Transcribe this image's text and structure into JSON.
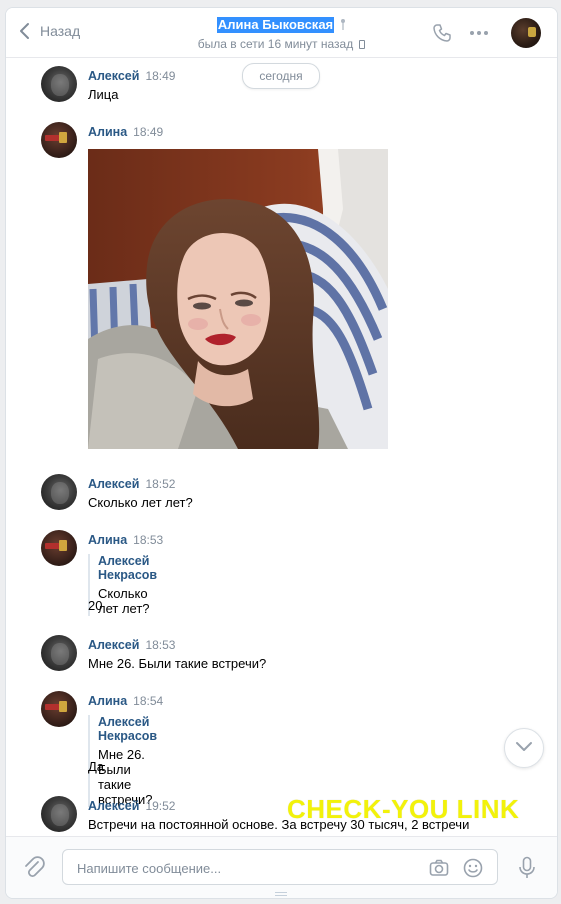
{
  "header": {
    "back_label": "Назад",
    "contact_name": "Алина Быковская",
    "status": "была в сети 16 минут назад"
  },
  "date_separator": "сегодня",
  "messages": [
    {
      "author": "Алексей",
      "time": "18:49",
      "text": "Лица"
    },
    {
      "author": "Алина",
      "time": "18:49",
      "attachment": "photo"
    },
    {
      "author": "Алексей",
      "time": "18:52",
      "text": "Сколько лет лет?"
    },
    {
      "author": "Алина",
      "time": "18:53",
      "quote_author": "Алексей Некрасов",
      "quote_text": "Сколько лет лет?",
      "text": "20"
    },
    {
      "author": "Алексей",
      "time": "18:53",
      "text": "Мне 26. Были такие встречи?"
    },
    {
      "author": "Алина",
      "time": "18:54",
      "quote_author": "Алексей Некрасов",
      "quote_text": "Мне 26. Были такие встречи?",
      "text": "Да"
    },
    {
      "author": "Алексей",
      "time": "19:52",
      "text": "Встречи на постоянной основе. За встречу 30 тысяч, 2 встречи"
    }
  ],
  "watermark": "CHECK-YOU LINK",
  "composer": {
    "placeholder": "Напишите сообщение..."
  },
  "colors": {
    "accent": "#2a5885",
    "selection": "#3390ff",
    "muted": "#818c99",
    "watermark": "#f2f20a"
  }
}
